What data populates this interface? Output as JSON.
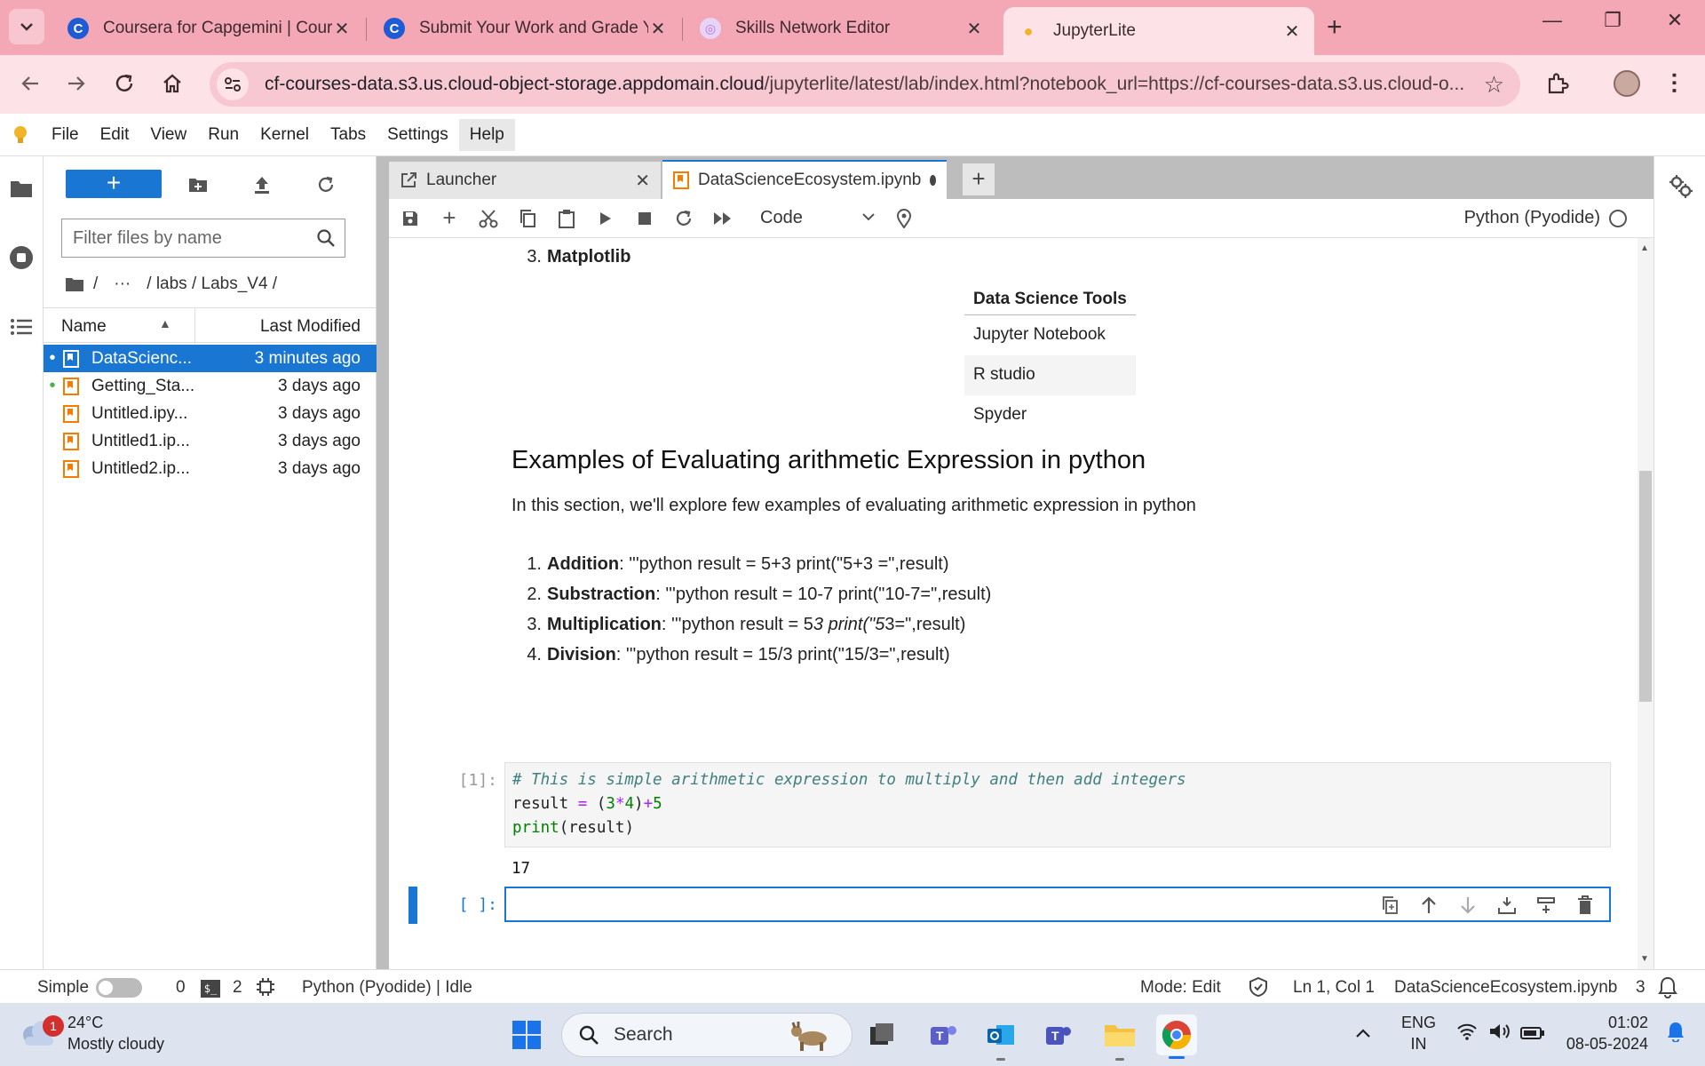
{
  "browser": {
    "tabs": [
      {
        "title": "Coursera for Capgemini | Cours",
        "favicon": "coursera-icon",
        "color": "#1f5bd6"
      },
      {
        "title": "Submit Your Work and Grade Yo",
        "favicon": "coursera-icon",
        "color": "#1f5bd6"
      },
      {
        "title": "Skills Network Editor",
        "favicon": "skills-network-icon",
        "color": "#b07ae0"
      },
      {
        "title": "JupyterLite",
        "favicon": "jupyterlite-icon",
        "color": "#f0b429"
      }
    ],
    "url_host": "cf-courses-data.s3.us.cloud-object-storage.appdomain.cloud",
    "url_path": "/jupyterlite/latest/lab/index.html?notebook_url=https://cf-courses-data.s3.us.cloud-o..."
  },
  "menu": [
    "File",
    "Edit",
    "View",
    "Run",
    "Kernel",
    "Tabs",
    "Settings",
    "Help"
  ],
  "filebrowser": {
    "new_label": "+",
    "filter_placeholder": "Filter files by name",
    "crumbs": [
      "/",
      "···",
      "/ labs / Labs_V4 /"
    ],
    "col_name": "Name",
    "col_modified": "Last Modified",
    "files": [
      {
        "name": "DataScienc...",
        "modified": "3 minutes ago",
        "running": true,
        "selected": true
      },
      {
        "name": "Getting_Sta...",
        "modified": "3 days ago",
        "running": true,
        "selected": false
      },
      {
        "name": "Untitled.ipy...",
        "modified": "3 days ago",
        "running": false,
        "selected": false
      },
      {
        "name": "Untitled1.ip...",
        "modified": "3 days ago",
        "running": false,
        "selected": false
      },
      {
        "name": "Untitled2.ip...",
        "modified": "3 days ago",
        "running": false,
        "selected": false
      }
    ]
  },
  "dock": {
    "tab_launcher": "Launcher",
    "tab_notebook": "DataScienceEcosystem.ipynb",
    "cell_type": "Code",
    "kernel": "Python (Pyodide)"
  },
  "notebook": {
    "prev_list_num": "3.",
    "prev_list_item": "Matplotlib",
    "table_header": "Data Science Tools",
    "table_rows": [
      "Jupyter Notebook",
      "R studio",
      "Spyder"
    ],
    "heading": "Examples of Evaluating arithmetic Expression in python",
    "intro": "In this section, we'll explore few examples of evaluating arithmetic expression in python",
    "examples": [
      {
        "num": "1.",
        "label": "Addition",
        "text": ": '''python result = 5+3 print(\"5+3 =\",result)"
      },
      {
        "num": "2.",
        "label": "Substraction",
        "text": ": '''python result = 10-7 print(\"10-7=\",result)"
      },
      {
        "num": "3.",
        "label": "Multiplication",
        "text_a": ": '''python result = 5",
        "text_b": "3 print(\"5",
        "text_c": "3=\",result)"
      },
      {
        "num": "4.",
        "label": "Division",
        "text": ": '''python result = 15/3 print(\"15/3=\",result)"
      }
    ],
    "code_prompt": "[1]:",
    "code_comment": "# This is simple arithmetic expression to multiply and then add integers",
    "code_line2_a": "result ",
    "code_line2_eq": "=",
    "code_line2_b": " (",
    "code_line2_n1": "3",
    "code_line2_op": "*",
    "code_line2_n2": "4",
    "code_line2_c": ")",
    "code_line2_plus": "+",
    "code_line2_n3": "5",
    "code_line3_fn": "print",
    "code_line3_rest": "(result)",
    "output": "17",
    "empty_prompt": "[ ]:"
  },
  "status": {
    "mode_label": "Simple",
    "count_a": "0",
    "count_b": "2",
    "kernel_status": "Python (Pyodide) | Idle",
    "mode": "Mode: Edit",
    "position": "Ln 1, Col 1",
    "filename": "DataScienceEcosystem.ipynb",
    "notifications": "3"
  },
  "taskbar": {
    "temp": "24°C",
    "weather": "Mostly cloudy",
    "weather_badge": "1",
    "search": "Search",
    "lang_top": "ENG",
    "lang_bottom": "IN",
    "time": "01:02",
    "date": "08-05-2024"
  }
}
